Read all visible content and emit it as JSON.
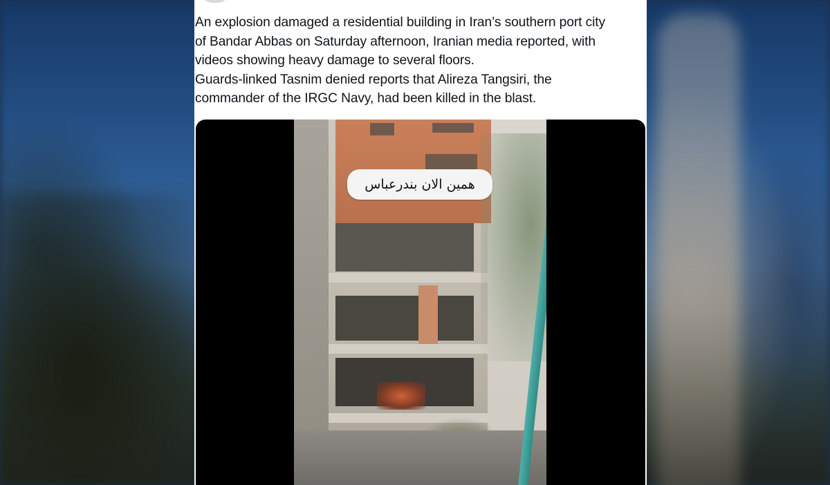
{
  "tweet": {
    "paragraphs": [
      "An explosion damaged a residential building in Iran’s southern port city",
      "of Bandar Abbas on Saturday afternoon, Iranian media reported, with",
      "videos showing heavy damage to several floors.",
      "Guards-linked Tasnim denied reports that Alireza Tangsiri, the",
      "commander of the IRGC Navy, had been killed in the blast."
    ]
  },
  "media": {
    "type": "video",
    "overlay_caption": "همین الان بندرعباس"
  },
  "colors": {
    "card_background": "#ffffff",
    "text": "#0f1419",
    "media_background": "#000000",
    "backdrop_sky": "#2b5a92"
  }
}
